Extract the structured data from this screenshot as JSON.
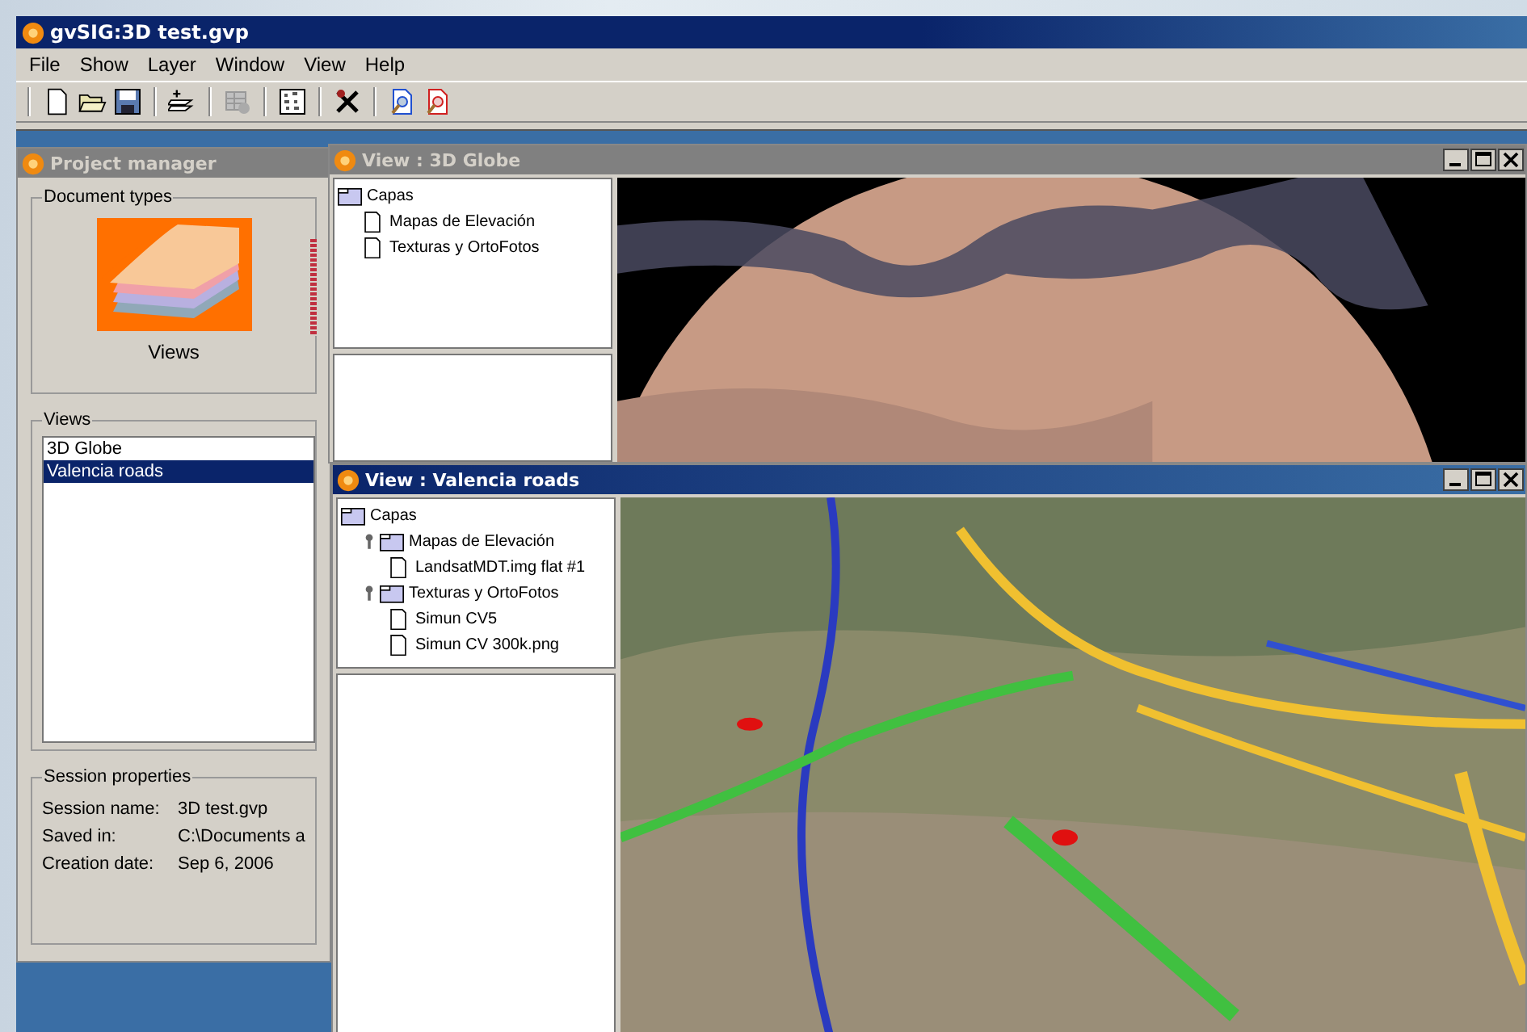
{
  "window": {
    "title": "gvSIG:3D test.gvp"
  },
  "menu": [
    "File",
    "Show",
    "Layer",
    "Window",
    "View",
    "Help"
  ],
  "project_manager": {
    "title": "Project manager",
    "document_types": {
      "label": "Document types",
      "items": [
        {
          "label": "Views"
        }
      ]
    },
    "views": {
      "label": "Views",
      "items": [
        {
          "label": "3D Globe",
          "selected": false
        },
        {
          "label": "Valencia roads",
          "selected": true
        }
      ]
    },
    "session": {
      "label": "Session properties",
      "rows": [
        {
          "label": "Session name:",
          "value": "3D test.gvp"
        },
        {
          "label": "Saved in:",
          "value": "C:\\Documents a"
        },
        {
          "label": "Creation date:",
          "value": "Sep 6, 2006"
        }
      ]
    }
  },
  "views_windows": [
    {
      "title": "View : 3D Globe",
      "active": false,
      "kind": "globe",
      "tree": {
        "label": "Capas",
        "kind": "folder",
        "children": [
          {
            "label": "Mapas de Elevación",
            "kind": "layer"
          },
          {
            "label": "Texturas y OrtoFotos",
            "kind": "layer"
          }
        ]
      }
    },
    {
      "title": "View : Valencia roads",
      "active": true,
      "kind": "terrain",
      "tree": {
        "label": "Capas",
        "kind": "folder",
        "children": [
          {
            "label": "Mapas de Elevación",
            "kind": "folder",
            "expanded": true,
            "children": [
              {
                "label": "LandsatMDT.img flat #1",
                "kind": "layer"
              }
            ]
          },
          {
            "label": "Texturas y OrtoFotos",
            "kind": "folder",
            "expanded": true,
            "children": [
              {
                "label": "Simun CV5",
                "kind": "layer"
              },
              {
                "label": "Simun CV 300k.png",
                "kind": "layer"
              }
            ]
          }
        ]
      }
    }
  ]
}
